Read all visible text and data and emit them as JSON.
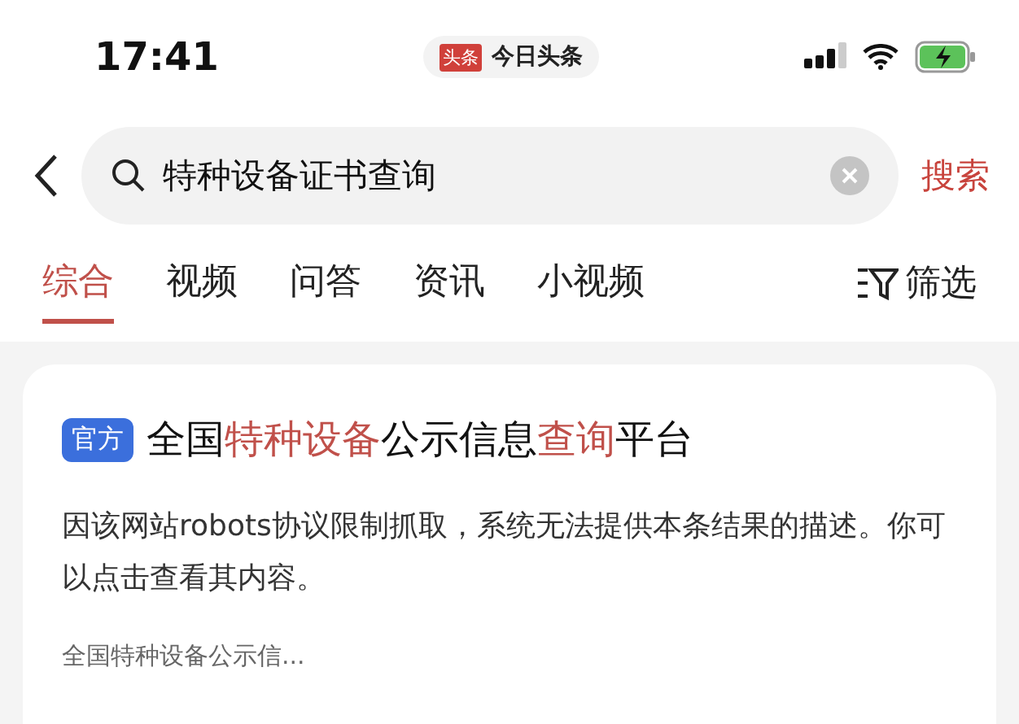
{
  "status_bar": {
    "time": "17:41",
    "app_badge": "头条",
    "app_name": "今日头条"
  },
  "search": {
    "value": "特种设备证书查询",
    "button": "搜索"
  },
  "tabs": [
    {
      "label": "综合",
      "selected": true
    },
    {
      "label": "视频",
      "selected": false
    },
    {
      "label": "问答",
      "selected": false
    },
    {
      "label": "资讯",
      "selected": false
    },
    {
      "label": "小视频",
      "selected": false
    }
  ],
  "filter": "筛选",
  "result": {
    "tag": "官方",
    "title": [
      {
        "text": "全国",
        "highlight": false
      },
      {
        "text": "特种设备",
        "highlight": true
      },
      {
        "text": "公示信息",
        "highlight": false
      },
      {
        "text": "查询",
        "highlight": true
      },
      {
        "text": "平台",
        "highlight": false
      }
    ],
    "description": "因该网站robots协议限制抓取，系统无法提供本条结果的描述。你可以点击查看其内容。",
    "source": "全国特种设备公示信..."
  }
}
